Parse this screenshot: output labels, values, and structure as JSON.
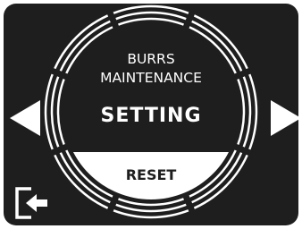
{
  "menu": {
    "title_line1": "BURRS",
    "title_line2": "MAINTENANCE",
    "current_option": "SETTING",
    "action_button_label": "RESET"
  },
  "controls": {
    "previous_icon": "triangle-left-icon",
    "next_icon": "triangle-right-icon",
    "exit_icon": "exit-door-arrow-icon"
  },
  "colors": {
    "background": "#1e1e1e",
    "foreground": "#ffffff"
  }
}
